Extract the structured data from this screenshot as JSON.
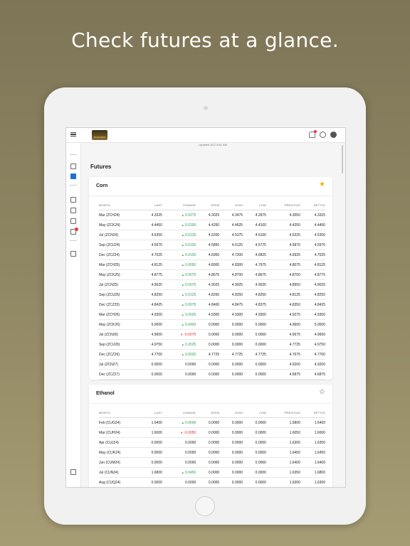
{
  "headline": "Check futures at a glance.",
  "app": {
    "logo_text": "RANCHERS",
    "updated_text": "Updated 3/12 8:51 AM",
    "page_title": "Futures"
  },
  "columns": [
    "MONTH",
    "LAST",
    "CHANGE",
    "OPEN",
    "HIGH",
    "LOW",
    "PREVIOUS",
    "SETTLE"
  ],
  "cards": [
    {
      "title": "Corn",
      "favorited": true,
      "rows": [
        {
          "month": "Mar (ZCH24)",
          "last": "4.3325",
          "change": "0.0275",
          "dir": "up",
          "open": "4.3025",
          "high": "4.3475",
          "low": "4.2875",
          "previous": "4.3050",
          "settle": "4.3325"
        },
        {
          "month": "May (ZCK24)",
          "last": "4.4450",
          "change": "0.0200",
          "dir": "up",
          "open": "4.4250",
          "high": "4.4625",
          "low": "4.4100",
          "previous": "4.4250",
          "settle": "4.4450"
        },
        {
          "month": "Jul (ZCN24)",
          "last": "4.5350",
          "change": "0.0125",
          "dir": "up",
          "open": "4.5200",
          "high": "4.5375",
          "low": "4.5100",
          "previous": "4.5225",
          "settle": "4.5350"
        },
        {
          "month": "Sep (ZCU24)",
          "last": "4.5975",
          "change": "0.0100",
          "dir": "up",
          "open": "4.5850",
          "high": "4.6125",
          "low": "4.5775",
          "previous": "4.5875",
          "settle": "4.5975"
        },
        {
          "month": "Dec (ZCZ24)",
          "last": "4.7025",
          "change": "0.0100",
          "dir": "up",
          "open": "4.6900",
          "high": "4.7200",
          "low": "4.6825",
          "previous": "4.6925",
          "settle": "4.7025"
        },
        {
          "month": "Mar (ZCH25)",
          "last": "4.8125",
          "change": "0.0050",
          "dir": "up",
          "open": "4.8000",
          "high": "4.8300",
          "low": "4.7975",
          "previous": "4.8075",
          "settle": "4.8125"
        },
        {
          "month": "May (ZCK25)",
          "last": "4.8775",
          "change": "0.0075",
          "dir": "up",
          "open": "4.8675",
          "high": "4.8700",
          "low": "4.8675",
          "previous": "4.8700",
          "settle": "4.8775"
        },
        {
          "month": "Jul (ZCN25)",
          "last": "4.9025",
          "change": "0.0075",
          "dir": "up",
          "open": "4.9025",
          "high": "4.9025",
          "low": "4.9025",
          "previous": "4.8950",
          "settle": "4.9025"
        },
        {
          "month": "Sep (ZCU25)",
          "last": "4.8250",
          "change": "0.0125",
          "dir": "up",
          "open": "4.8250",
          "high": "4.8250",
          "low": "4.8250",
          "previous": "4.8125",
          "settle": "4.8250"
        },
        {
          "month": "Dec (ZCZ25)",
          "last": "4.8425",
          "change": "0.0075",
          "dir": "up",
          "open": "4.8400",
          "high": "4.8475",
          "low": "4.8375",
          "previous": "4.8350",
          "settle": "4.8425"
        },
        {
          "month": "Mar (ZCH26)",
          "last": "4.9300",
          "change": "0.0025",
          "dir": "up",
          "open": "4.9300",
          "high": "4.9300",
          "low": "4.9300",
          "previous": "4.9275",
          "settle": "4.9300"
        },
        {
          "month": "May (ZCK26)",
          "last": "5.0000",
          "change": "0.0400",
          "dir": "up",
          "open": "0.0000",
          "high": "0.0000",
          "low": "0.0000",
          "previous": "4.9600",
          "settle": "5.0000"
        },
        {
          "month": "Jul (ZCN26)",
          "last": "4.9600",
          "change": "-0.0075",
          "dir": "down",
          "open": "0.0000",
          "high": "0.0000",
          "low": "0.0000",
          "previous": "4.9675",
          "settle": "4.9600"
        },
        {
          "month": "Sep (ZCU26)",
          "last": "4.9750",
          "change": "0.2025",
          "dir": "up",
          "open": "0.0000",
          "high": "0.0000",
          "low": "0.0000",
          "previous": "4.7725",
          "settle": "4.9750"
        },
        {
          "month": "Dec (ZCZ26)",
          "last": "4.7700",
          "change": "0.0025",
          "dir": "up",
          "open": "4.7725",
          "high": "4.7725",
          "low": "4.7725",
          "previous": "4.7675",
          "settle": "4.7700"
        },
        {
          "month": "Jul (ZCN27)",
          "last": "0.0000",
          "change": "0.0000",
          "dir": "none",
          "open": "0.0000",
          "high": "0.0000",
          "low": "0.0000",
          "previous": "4.9200",
          "settle": "4.9200"
        },
        {
          "month": "Dec (ZCZ27)",
          "last": "0.0000",
          "change": "0.0000",
          "dir": "none",
          "open": "0.0000",
          "high": "0.0000",
          "low": "0.0000",
          "previous": "4.6875",
          "settle": "4.6875"
        }
      ]
    },
    {
      "title": "Ethanol",
      "favorited": false,
      "rows": [
        {
          "month": "Feb (CUG24)",
          "last": "1.6400",
          "change": "0.0600",
          "dir": "up",
          "open": "0.0000",
          "high": "0.0000",
          "low": "0.0000",
          "previous": "1.5800",
          "settle": "1.6400"
        },
        {
          "month": "Mar (CUH24)",
          "last": "1.6000",
          "change": "-0.0050",
          "dir": "down",
          "open": "0.0000",
          "high": "0.0000",
          "low": "0.0000",
          "previous": "1.6050",
          "settle": "1.6000"
        },
        {
          "month": "Apr (CUJ24)",
          "last": "0.0000",
          "change": "0.0000",
          "dir": "none",
          "open": "0.0000",
          "high": "0.0000",
          "low": "0.0000",
          "previous": "1.6300",
          "settle": "1.6300"
        },
        {
          "month": "May (CUK24)",
          "last": "0.0000",
          "change": "0.0000",
          "dir": "none",
          "open": "0.0000",
          "high": "0.0000",
          "low": "0.0000",
          "previous": "1.6450",
          "settle": "1.6450"
        },
        {
          "month": "Jun (CUM24)",
          "last": "0.0000",
          "change": "0.0000",
          "dir": "none",
          "open": "0.0000",
          "high": "0.0000",
          "low": "0.0000",
          "previous": "1.6400",
          "settle": "1.6400"
        },
        {
          "month": "Jul (CUN24)",
          "last": "1.6800",
          "change": "0.0450",
          "dir": "up",
          "open": "0.0000",
          "high": "0.0000",
          "low": "0.0000",
          "previous": "1.6350",
          "settle": "1.6800"
        },
        {
          "month": "Aug (CUQ24)",
          "last": "0.0000",
          "change": "0.0000",
          "dir": "none",
          "open": "0.0000",
          "high": "0.0000",
          "low": "0.0000",
          "previous": "1.6300",
          "settle": "1.6300"
        }
      ]
    }
  ]
}
